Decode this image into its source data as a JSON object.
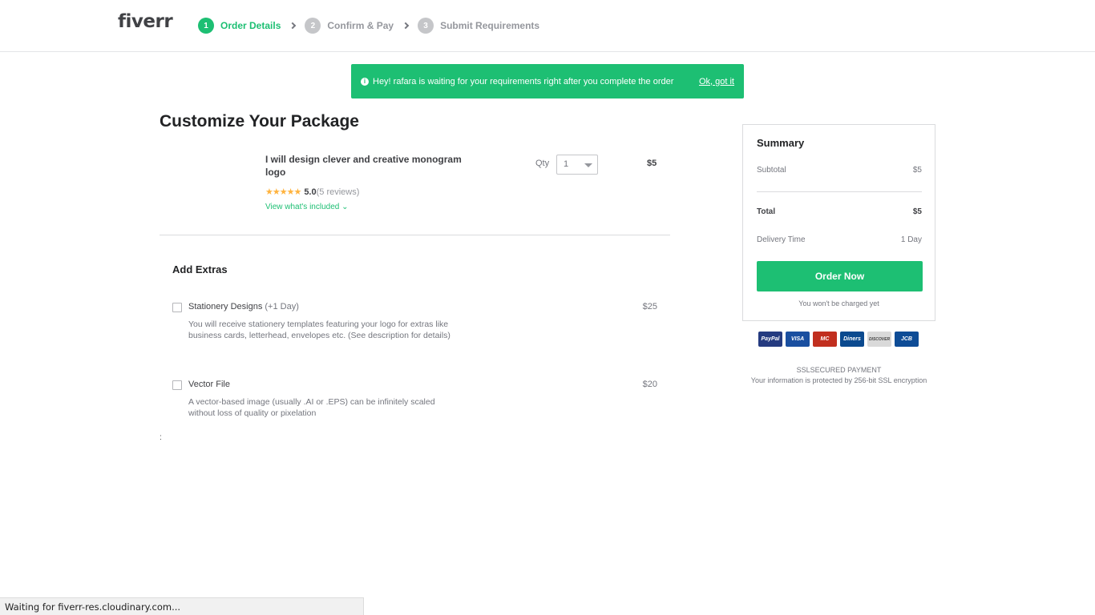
{
  "header": {
    "logo": "fiverr",
    "steps": [
      {
        "num": "1",
        "label": "Order Details"
      },
      {
        "num": "2",
        "label": "Confirm & Pay"
      },
      {
        "num": "3",
        "label": "Submit Requirements"
      }
    ]
  },
  "notice": {
    "text": "Hey! rafara is waiting for your requirements right after you complete the order",
    "ok_label": "Ok, got it",
    "icon": "info-icon"
  },
  "main": {
    "title": "Customize Your Package",
    "gig": {
      "title": "I will design clever and creative monogram logo",
      "stars": "★★★★★",
      "rating": "5.0",
      "reviews": "(5 reviews)",
      "view_included": "View what's included ⌄",
      "qty_label": "Qty",
      "qty_value": "1",
      "price": "$5"
    },
    "extras_title": "Add Extras",
    "extras": [
      {
        "name": "Stationery Designs",
        "suffix": " (+1 Day)",
        "desc": "You will receive stationery templates featuring your logo for extras like business cards, letterhead, envelopes etc. (See description for details)",
        "price": "$25"
      },
      {
        "name": "Vector File",
        "suffix": "",
        "desc": "A vector-based image (usually .AI or .EPS) can be infinitely scaled without loss of quality or pixelation",
        "price": "$20"
      }
    ],
    "colon": ":"
  },
  "summary": {
    "title": "Summary",
    "subtotal_label": "Subtotal",
    "subtotal_value": "$5",
    "total_label": "Total",
    "total_value": "$5",
    "delivery_label": "Delivery Time",
    "delivery_value": "1 Day",
    "order_button": "Order Now",
    "no_charge": "You won't be charged yet"
  },
  "payment": {
    "cards": [
      {
        "label": "PayPal",
        "color": "#253b80"
      },
      {
        "label": "VISA",
        "color": "#1a4fa0"
      },
      {
        "label": "MC",
        "color": "#c12f1f"
      },
      {
        "label": "Diners",
        "color": "#0b4a8f"
      },
      {
        "label": "DISCOVER",
        "color": "#d9d9d9"
      },
      {
        "label": "JCB",
        "color": "#0e4c96"
      }
    ],
    "ssl_title": "SSLSECURED PAYMENT",
    "ssl_text": "Your information is protected by 256-bit SSL encryption"
  },
  "status_bar": "Waiting for fiverr-res.cloudinary.com..."
}
